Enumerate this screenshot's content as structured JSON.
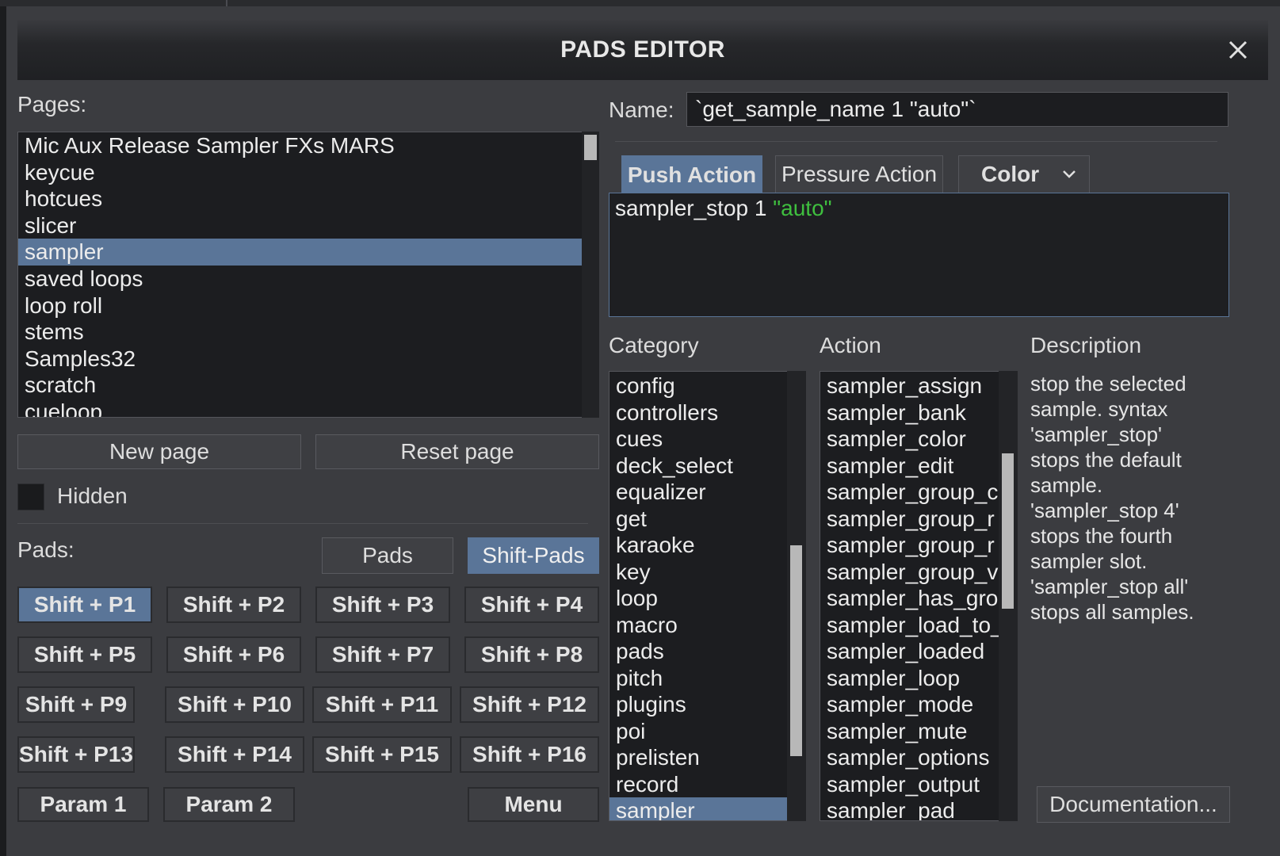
{
  "window": {
    "title": "PADS EDITOR"
  },
  "pages": {
    "label": "Pages:",
    "items": [
      "Mic Aux Release Sampler FXs MARS",
      "keycue",
      "hotcues",
      "slicer",
      "sampler",
      "saved loops",
      "loop roll",
      "stems",
      "Samples32",
      "scratch",
      "cueloop"
    ],
    "selected": "sampler",
    "new_page": "New page",
    "reset_page": "Reset page",
    "hidden_label": "Hidden"
  },
  "pads": {
    "label": "Pads:",
    "toggle": [
      "Pads",
      "Shift-Pads"
    ],
    "toggle_selected": "Shift-Pads",
    "buttons": [
      "Shift + P1",
      "Shift + P2",
      "Shift + P3",
      "Shift + P4",
      "Shift + P5",
      "Shift + P6",
      "Shift + P7",
      "Shift + P8",
      "Shift + P9",
      "Shift + P10",
      "Shift + P11",
      "Shift + P12",
      "Shift + P13",
      "Shift + P14",
      "Shift + P15",
      "Shift + P16"
    ],
    "selected_button": "Shift + P1",
    "param1": "Param 1",
    "param2": "Param 2",
    "menu": "Menu"
  },
  "editor": {
    "name_label": "Name:",
    "name_value": "`get_sample_name 1 \"auto\"`",
    "tabs": [
      "Push Action",
      "Pressure Action",
      "Color"
    ],
    "active_tab": "Push Action",
    "script_command": "sampler_stop 1 ",
    "script_string": "\"auto\"",
    "string_color": "#3fbf3f"
  },
  "category": {
    "label": "Category",
    "items": [
      "config",
      "controllers",
      "cues",
      "deck_select",
      "equalizer",
      "get",
      "karaoke",
      "key",
      "loop",
      "macro",
      "pads",
      "pitch",
      "plugins",
      "poi",
      "prelisten",
      "record",
      "sampler"
    ],
    "selected": "sampler"
  },
  "action": {
    "label": "Action",
    "items": [
      "sampler_assign",
      "sampler_bank",
      "sampler_color",
      "sampler_edit",
      "sampler_group_c",
      "sampler_group_r",
      "sampler_group_r",
      "sampler_group_v",
      "sampler_has_gro",
      "sampler_load_to_",
      "sampler_loaded",
      "sampler_loop",
      "sampler_mode",
      "sampler_mute",
      "sampler_options",
      "sampler_output",
      "sampler_pad"
    ]
  },
  "description": {
    "label": "Description",
    "lines": [
      "stop the selected",
      "sample. syntax",
      "'sampler_stop'",
      "stops the default",
      "sample.",
      "'sampler_stop 4'",
      "stops the fourth",
      "sampler slot.",
      "'sampler_stop all'",
      "stops all samples."
    ],
    "documentation_button": "Documentation..."
  },
  "colors": {
    "accent": "#5a7598",
    "background": "#3b3c40",
    "list_background": "#1c1d20"
  }
}
